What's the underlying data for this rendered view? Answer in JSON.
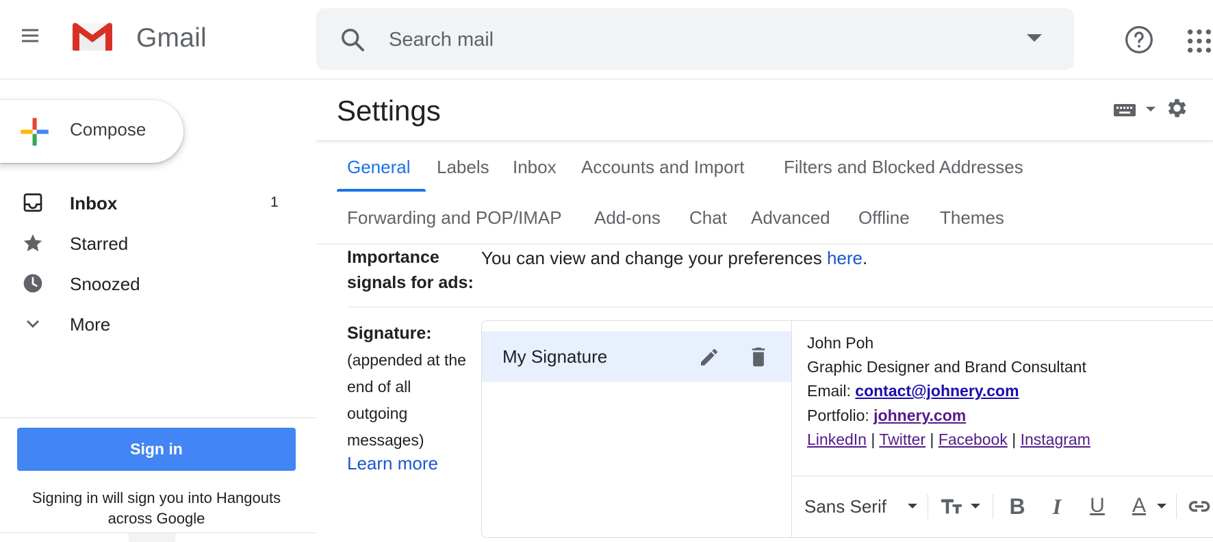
{
  "header": {
    "app_name": "Gmail",
    "menu_icon": "hamburger-menu-icon",
    "search": {
      "placeholder": "Search mail",
      "value": ""
    },
    "help_icon": "help-circle-icon",
    "apps_icon": "apps-grid-icon"
  },
  "sidebar": {
    "compose_label": "Compose",
    "items": [
      {
        "label": "Inbox",
        "icon": "inbox-icon",
        "count": "1",
        "bold": true
      },
      {
        "label": "Starred",
        "icon": "star-icon",
        "count": ""
      },
      {
        "label": "Snoozed",
        "icon": "clock-icon",
        "count": ""
      },
      {
        "label": "More",
        "icon": "chevron-down-icon",
        "count": ""
      }
    ],
    "sign_in": {
      "button_label": "Sign in",
      "note": "Signing in will sign you into Hangouts across Google"
    }
  },
  "settings": {
    "title": "Settings",
    "tabs_row1": [
      "General",
      "Labels",
      "Inbox",
      "Accounts and Import",
      "Filters and Blocked Addresses"
    ],
    "tabs_row2": [
      "Forwarding and POP/IMAP",
      "Add-ons",
      "Chat",
      "Advanced",
      "Offline",
      "Themes"
    ],
    "active_tab": "General",
    "importance": {
      "label_line1": "Importance",
      "label_line2": "signals for ads:",
      "text": "You can view and change your preferences ",
      "link": "here",
      "suffix": "."
    },
    "signature": {
      "label": "Signature:",
      "desc_lines": [
        "(appended at the",
        "end of all",
        "outgoing",
        "messages)"
      ],
      "learn_more": "Learn more",
      "list": [
        {
          "name": "My Signature"
        }
      ],
      "content": {
        "name": "John Poh",
        "title": "Graphic Designer and Brand Consultant",
        "email_label": "Email: ",
        "email": "contact@johnery.com",
        "portfolio_label": "Portfolio: ",
        "portfolio": "johnery.com",
        "socials": [
          "LinkedIn",
          "Twitter",
          "Facebook",
          "Instagram"
        ],
        "separator": " | "
      },
      "toolbar": {
        "font": "Sans Serif",
        "bold": "B",
        "italic": "I",
        "underline": "U",
        "text_color": "A"
      }
    }
  },
  "colors": {
    "accent_blue": "#1a73e8",
    "signin_blue": "#4285f4",
    "link_blue": "#1a56cc",
    "selected_row": "#e8f0fe",
    "visited_purple": "#551a8b"
  }
}
